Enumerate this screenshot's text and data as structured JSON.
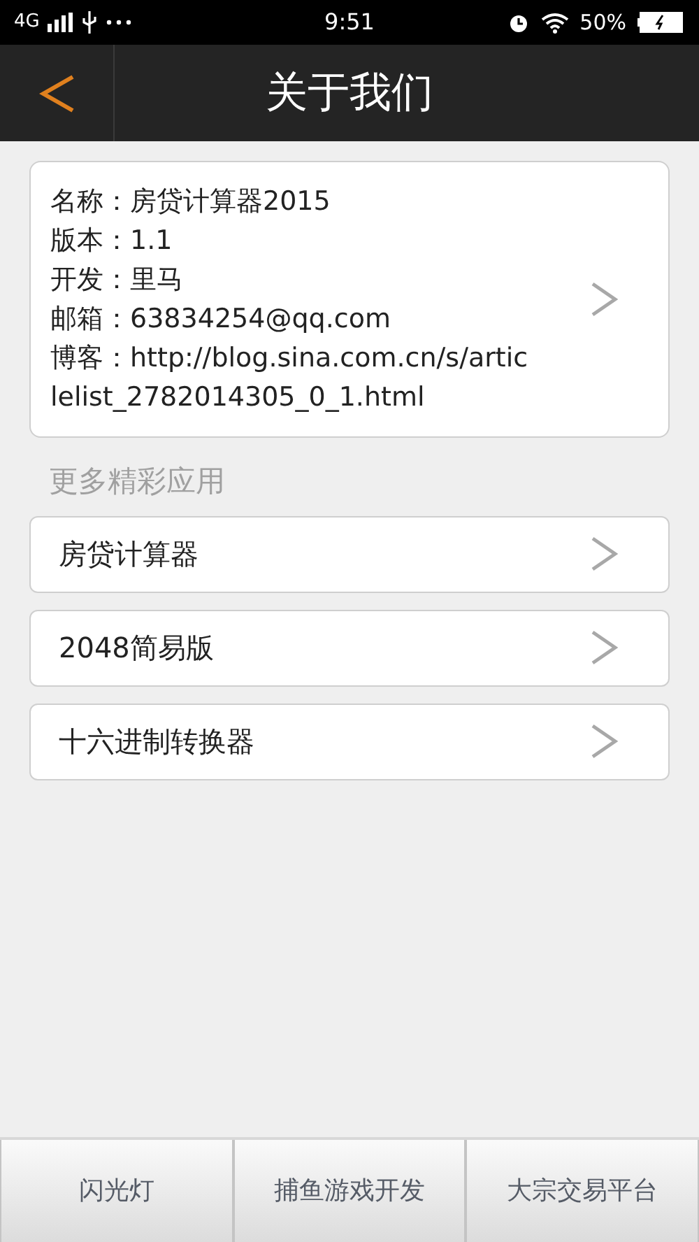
{
  "status_bar": {
    "network": "4G",
    "time": "9:51",
    "battery": "50%"
  },
  "header": {
    "title": "关于我们"
  },
  "info_card": {
    "lines": [
      "名称：房贷计算器2015",
      "版本：1.1",
      "开发：里马",
      "邮箱：63834254@qq.com",
      "博客：http://blog.sina.com.cn/s/articlelist_2782014305_0_1.html"
    ]
  },
  "section_title": "更多精彩应用",
  "apps": [
    {
      "label": "房贷计算器"
    },
    {
      "label": "2048简易版"
    },
    {
      "label": "十六进制转换器"
    }
  ],
  "bottom_tabs": [
    {
      "label": "闪光灯"
    },
    {
      "label": "捕鱼游戏开发"
    },
    {
      "label": "大宗交易平台"
    }
  ]
}
